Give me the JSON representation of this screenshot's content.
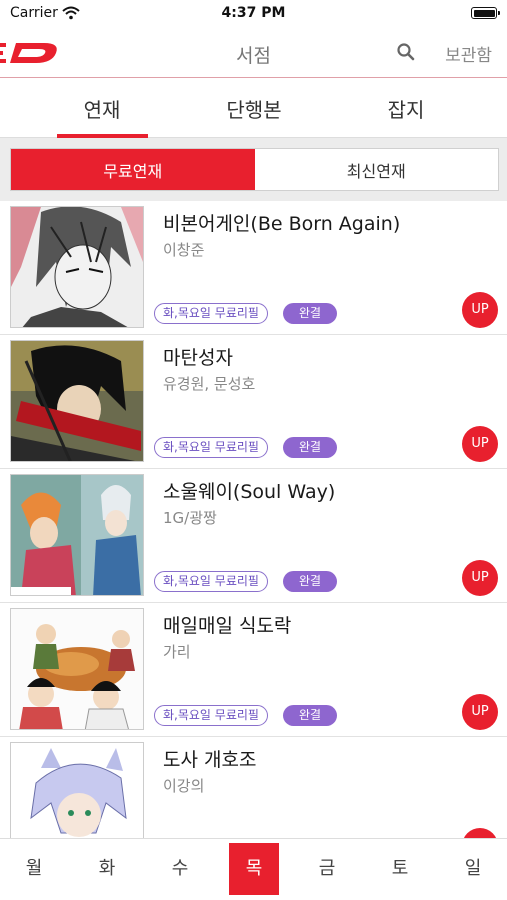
{
  "status": {
    "carrier": "Carrier",
    "time": "4:37 PM"
  },
  "nav": {
    "title": "서점",
    "locker": "보관함"
  },
  "tabs": [
    "연재",
    "단행본",
    "잡지"
  ],
  "segment": {
    "active": "무료연재",
    "inactive": "최신연재"
  },
  "items": [
    {
      "title": "비본어게인(Be Born Again)",
      "author": "이창준",
      "day_tag": "화,목요일 무료리필",
      "status": "완결",
      "badge": "UP"
    },
    {
      "title": "마탄성자",
      "author": "유경원, 문성호",
      "day_tag": "화,목요일 무료리필",
      "status": "완결",
      "badge": "UP"
    },
    {
      "title": "소울웨이(Soul Way)",
      "author": "1G/광짱",
      "day_tag": "화,목요일 무료리필",
      "status": "완결",
      "badge": "UP"
    },
    {
      "title": "매일매일 식도락",
      "author": "가리",
      "day_tag": "화,목요일 무료리필",
      "status": "완결",
      "badge": "UP"
    },
    {
      "title": "도사 개호조",
      "author": "이강의",
      "day_tag": "",
      "status": "",
      "badge": "UP"
    }
  ],
  "days": [
    "월",
    "화",
    "수",
    "목",
    "금",
    "토",
    "일"
  ],
  "active_day": "목",
  "colors": {
    "accent": "#e8202e",
    "tag": "#8e66cf"
  }
}
